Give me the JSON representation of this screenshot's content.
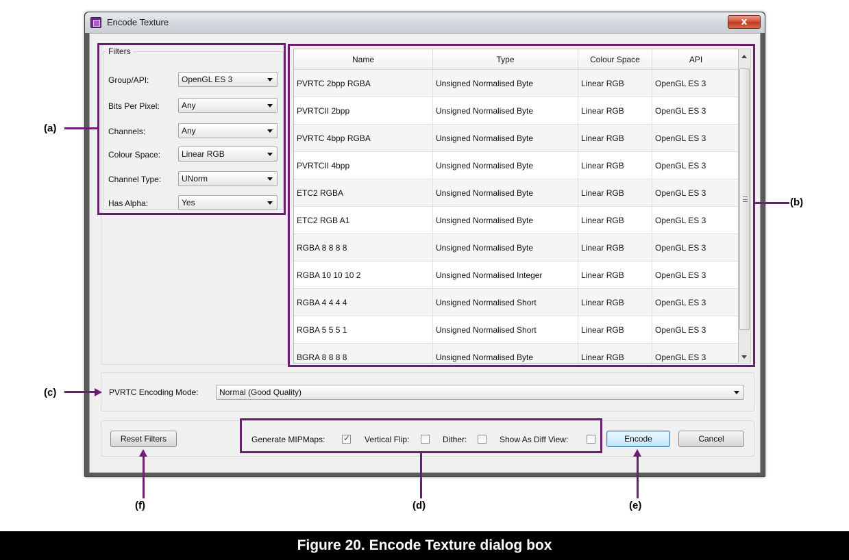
{
  "window": {
    "title": "Encode Texture",
    "close_glyph": "x"
  },
  "filters": {
    "title": "Filters",
    "items": [
      {
        "label": "Group/API:",
        "value": "OpenGL ES 3"
      },
      {
        "label": "Bits Per Pixel:",
        "value": "Any"
      },
      {
        "label": "Channels:",
        "value": "Any"
      },
      {
        "label": "Colour Space:",
        "value": "Linear RGB"
      },
      {
        "label": "Channel Type:",
        "value": "UNorm"
      },
      {
        "label": "Has Alpha:",
        "value": "Yes"
      }
    ]
  },
  "table": {
    "columns": [
      "Name",
      "Type",
      "Colour Space",
      "API"
    ],
    "rows": [
      [
        "PVRTC 2bpp RGBA",
        "Unsigned Normalised Byte",
        "Linear RGB",
        "OpenGL ES 3"
      ],
      [
        "PVRTCII 2bpp",
        "Unsigned Normalised Byte",
        "Linear RGB",
        "OpenGL ES 3"
      ],
      [
        "PVRTC 4bpp RGBA",
        "Unsigned Normalised Byte",
        "Linear RGB",
        "OpenGL ES 3"
      ],
      [
        "PVRTCII 4bpp",
        "Unsigned Normalised Byte",
        "Linear RGB",
        "OpenGL ES 3"
      ],
      [
        "ETC2 RGBA",
        "Unsigned Normalised Byte",
        "Linear RGB",
        "OpenGL ES 3"
      ],
      [
        "ETC2 RGB A1",
        "Unsigned Normalised Byte",
        "Linear RGB",
        "OpenGL ES 3"
      ],
      [
        "RGBA 8 8 8 8",
        "Unsigned Normalised Byte",
        "Linear RGB",
        "OpenGL ES 3"
      ],
      [
        "RGBA 10 10 10 2",
        "Unsigned Normalised Integer",
        "Linear RGB",
        "OpenGL ES 3"
      ],
      [
        "RGBA 4 4 4 4",
        "Unsigned Normalised Short",
        "Linear RGB",
        "OpenGL ES 3"
      ],
      [
        "RGBA 5 5 5 1",
        "Unsigned Normalised Short",
        "Linear RGB",
        "OpenGL ES 3"
      ],
      [
        "BGRA 8 8 8 8",
        "Unsigned Normalised Byte",
        "Linear RGB",
        "OpenGL ES 3"
      ]
    ]
  },
  "encoding": {
    "label": "PVRTC Encoding Mode:",
    "value": "Normal (Good Quality)"
  },
  "options": {
    "generate_mipmaps": {
      "label": "Generate MIPMaps:",
      "checked": true
    },
    "vertical_flip": {
      "label": "Vertical Flip:",
      "checked": false
    },
    "dither": {
      "label": "Dither:",
      "checked": false
    },
    "show_diff": {
      "label": "Show As Diff View:",
      "checked": false
    }
  },
  "buttons": {
    "reset": "Reset Filters",
    "encode": "Encode",
    "cancel": "Cancel"
  },
  "annotations": {
    "a": "(a)",
    "b": "(b)",
    "c": "(c)",
    "d": "(d)",
    "e": "(e)",
    "f": "(f)"
  },
  "caption": "Figure 20. Encode Texture dialog box",
  "colors": {
    "annotation": "#6b1f6f",
    "caption_bg": "#000000"
  }
}
